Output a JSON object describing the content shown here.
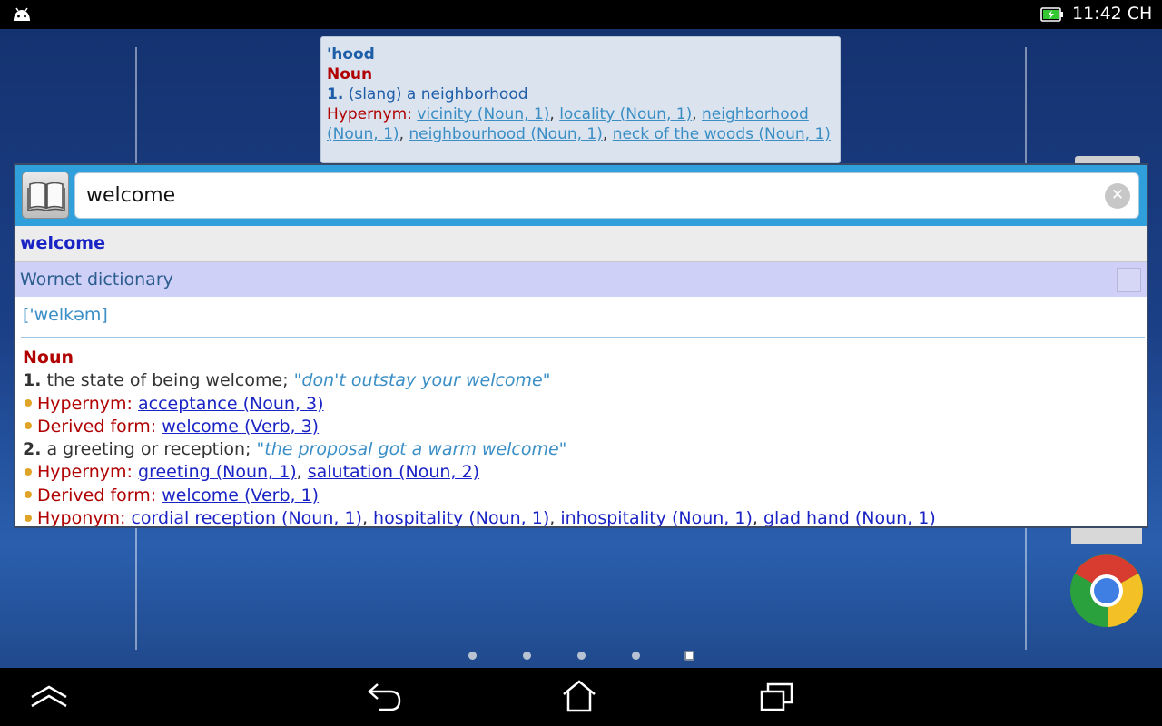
{
  "status_bar": {
    "time": "11:42 CH"
  },
  "background_card": {
    "headword": "'hood",
    "pos": "Noun",
    "sense_num": "1.",
    "sense_def": "(slang) a neighborhood",
    "hypernym_label": "Hypernym:",
    "links": [
      "vicinity (Noun, 1)",
      "locality (Noun, 1)",
      "neighborhood",
      "(Noun, 1)",
      "neighbourhood (Noun, 1)",
      "neck of the woods (Noun, 1)"
    ]
  },
  "search": {
    "value": "welcome"
  },
  "result": {
    "word": "welcome",
    "dictionary_name": "Wornet dictionary",
    "pronunciation": "['welkəm]",
    "pos": "Noun",
    "senses": [
      {
        "num": "1.",
        "definition": "the state of being welcome;",
        "example": "\"don't outstay your welcome\"",
        "relations": [
          {
            "label": "Hypernym:",
            "links": [
              "acceptance (Noun, 3)"
            ]
          },
          {
            "label": "Derived form:",
            "links": [
              "welcome (Verb, 3)"
            ]
          }
        ]
      },
      {
        "num": "2.",
        "definition": "a greeting or reception;",
        "example": "\"the proposal got a warm welcome\"",
        "relations": [
          {
            "label": "Hypernym:",
            "links": [
              "greeting (Noun, 1)",
              "salutation (Noun, 2)"
            ]
          },
          {
            "label": "Derived form:",
            "links": [
              "welcome (Verb, 1)"
            ]
          },
          {
            "label": "Hyponym:",
            "links": [
              "cordial reception (Noun, 1)",
              "hospitality (Noun, 1)",
              "inhospitality (Noun, 1)",
              "glad hand (Noun, 1)"
            ]
          }
        ]
      }
    ]
  },
  "colors": {
    "accent": "#2fa0dc",
    "pos_red": "#b00000",
    "link_blue": "#1a23c4",
    "dict_header_bg": "#cfd0f7",
    "bullet": "#e0a528"
  },
  "icons": [
    "android-icon",
    "battery-charging-icon",
    "book-icon",
    "clear-icon",
    "chrome-icon",
    "nav-up-icon",
    "nav-back-icon",
    "nav-home-icon",
    "nav-recent-icon"
  ]
}
